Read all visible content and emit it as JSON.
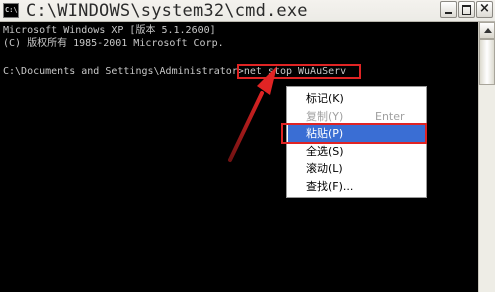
{
  "window": {
    "title": "C:\\WINDOWS\\system32\\cmd.exe",
    "icon_text": "C:\\",
    "buttons": {
      "close_label": "×"
    }
  },
  "console": {
    "lines": [
      "Microsoft Windows XP [版本 5.1.2600]",
      "(C) 版权所有 1985-2001 Microsoft Corp.",
      "",
      "C:\\Documents and Settings\\Administrator>net stop WuAuServ"
    ]
  },
  "context_menu": {
    "items": [
      {
        "label": "标记(K)",
        "shortcut": "",
        "state": "normal"
      },
      {
        "label": "复制(Y)",
        "shortcut": "Enter",
        "state": "disabled"
      },
      {
        "label": "粘贴(P)",
        "shortcut": "",
        "state": "selected"
      },
      {
        "label": "全选(S)",
        "shortcut": "",
        "state": "normal"
      },
      {
        "label": "滚动(L)",
        "shortcut": "",
        "state": "normal"
      },
      {
        "label": "查找(F)...",
        "shortcut": "",
        "state": "normal"
      }
    ]
  },
  "colors": {
    "console_bg": "#000000",
    "console_text": "#c8c8c8",
    "highlight": "#e02424",
    "menu_selection": "#3a6ed4"
  }
}
